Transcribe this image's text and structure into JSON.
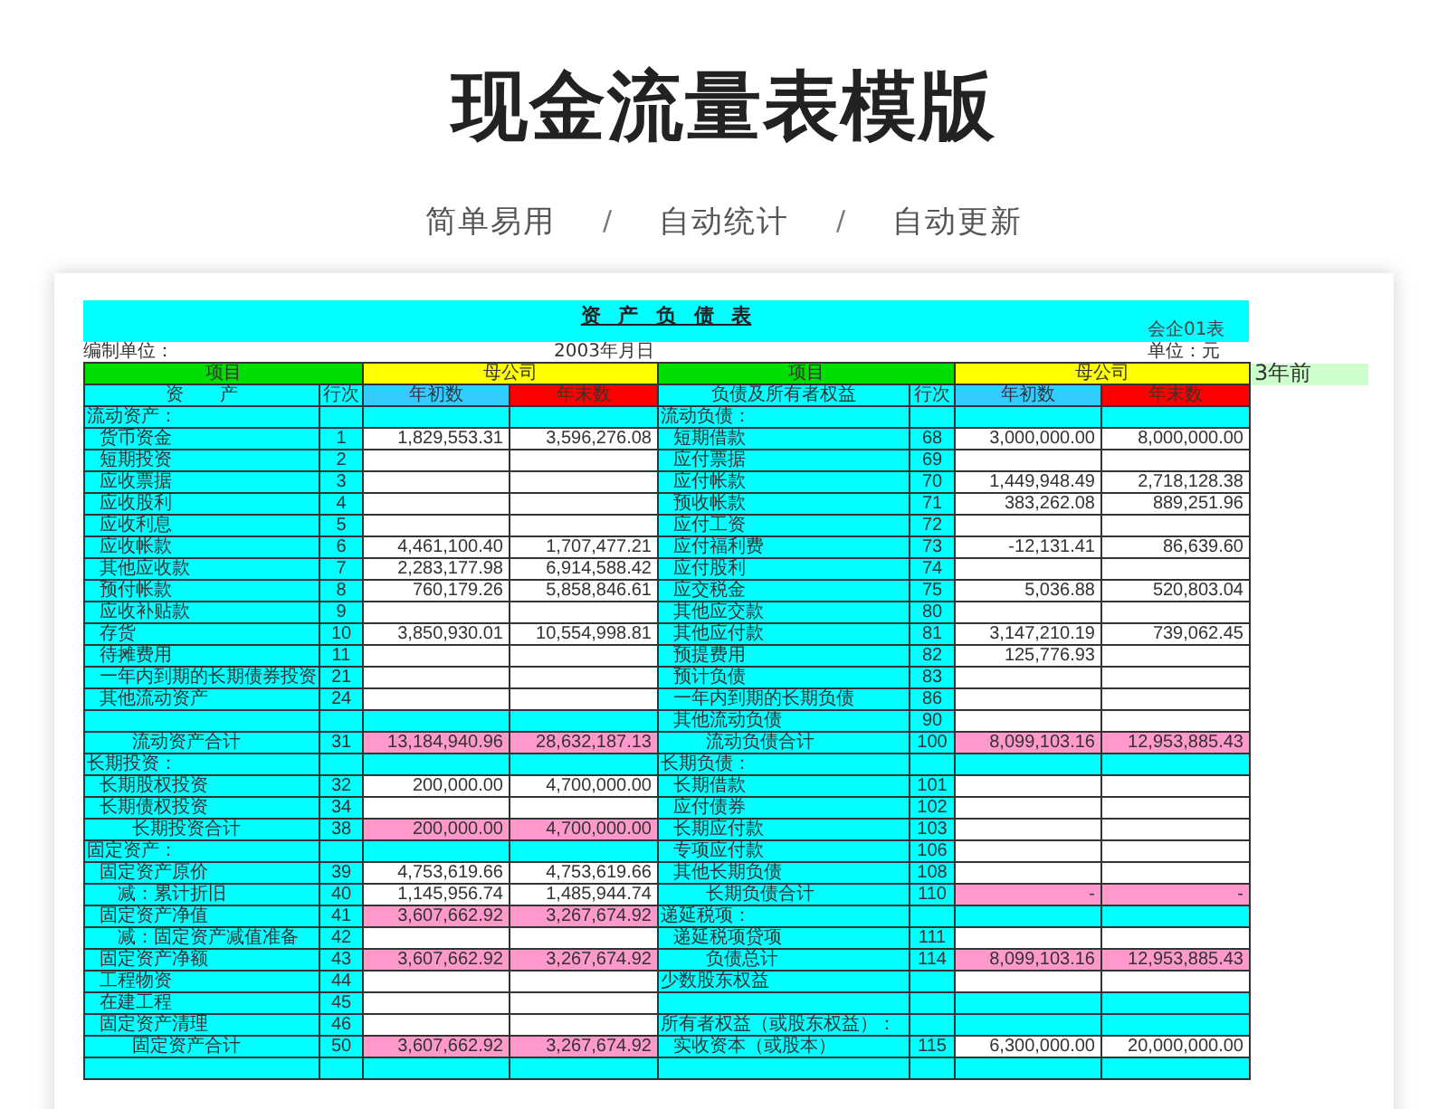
{
  "page_title": "现金流量表模版",
  "tagline": [
    {
      "kind": "phrase",
      "text": "简单易用"
    },
    {
      "kind": "separator",
      "text": "/"
    },
    {
      "kind": "phrase",
      "text": "自动统计"
    },
    {
      "kind": "separator",
      "text": "/"
    },
    {
      "kind": "phrase",
      "text": "自动更新"
    }
  ],
  "sheet": {
    "title": "资 产 负 债 表",
    "form_code": "会企01表",
    "company_label": "编制单位：",
    "date": "2003年月日",
    "unit": "单位：元",
    "group_headers": [
      {
        "label": "项目",
        "color": "#00dd00"
      },
      {
        "label": "母公司",
        "color": "#ffff00"
      },
      {
        "label": "项目",
        "color": "#00dd00"
      },
      {
        "label": "母公司",
        "color": "#ffff00"
      }
    ],
    "side_note": "3年前",
    "columns": [
      {
        "label": "资　　产",
        "color": "#00ffff"
      },
      {
        "label": "行次",
        "color": "#00ffff"
      },
      {
        "label": "年初数",
        "color": "#33ccff"
      },
      {
        "label": "年末数",
        "color": "#ff0000"
      },
      {
        "label": "负债及所有者权益",
        "color": "#00ffff"
      },
      {
        "label": "行次",
        "color": "#00ffff"
      },
      {
        "label": "年初数",
        "color": "#33ccff"
      },
      {
        "label": "年末数",
        "color": "#ff0000"
      }
    ],
    "rows": [
      {
        "left": {
          "kind": "section",
          "label": "流动资产："
        },
        "right": {
          "kind": "section",
          "label": "流动负债："
        }
      },
      {
        "left": {
          "kind": "item",
          "label": "货币资金",
          "line": "1",
          "start": "1,829,553.31",
          "end": "3,596,276.08"
        },
        "right": {
          "kind": "item",
          "label": "短期借款",
          "line": "68",
          "start": "3,000,000.00",
          "end": "8,000,000.00"
        }
      },
      {
        "left": {
          "kind": "item",
          "label": "短期投资",
          "line": "2"
        },
        "right": {
          "kind": "item",
          "label": "应付票据",
          "line": "69"
        }
      },
      {
        "left": {
          "kind": "item",
          "label": "应收票据",
          "line": "3"
        },
        "right": {
          "kind": "item",
          "label": "应付帐款",
          "line": "70",
          "start": "1,449,948.49",
          "end": "2,718,128.38"
        }
      },
      {
        "left": {
          "kind": "item",
          "label": "应收股利",
          "line": "4"
        },
        "right": {
          "kind": "item",
          "label": "预收帐款",
          "line": "71",
          "start": "383,262.08",
          "end": "889,251.96"
        }
      },
      {
        "left": {
          "kind": "item",
          "label": "应收利息",
          "line": "5"
        },
        "right": {
          "kind": "item",
          "label": "应付工资",
          "line": "72"
        }
      },
      {
        "left": {
          "kind": "item",
          "label": "应收帐款",
          "line": "6",
          "start": "4,461,100.40",
          "end": "1,707,477.21"
        },
        "right": {
          "kind": "item",
          "label": "应付福利费",
          "line": "73",
          "start": "-12,131.41",
          "end": "86,639.60"
        }
      },
      {
        "left": {
          "kind": "item",
          "label": "其他应收款",
          "line": "7",
          "start": "2,283,177.98",
          "end": "6,914,588.42"
        },
        "right": {
          "kind": "item",
          "label": "应付股利",
          "line": "74"
        }
      },
      {
        "left": {
          "kind": "item",
          "label": "预付帐款",
          "line": "8",
          "start": "760,179.26",
          "end": "5,858,846.61"
        },
        "right": {
          "kind": "item",
          "label": "应交税金",
          "line": "75",
          "start": "5,036.88",
          "end": "520,803.04"
        }
      },
      {
        "left": {
          "kind": "item",
          "label": "应收补贴款",
          "line": "9"
        },
        "right": {
          "kind": "item",
          "label": "其他应交款",
          "line": "80"
        }
      },
      {
        "left": {
          "kind": "item",
          "label": "存货",
          "line": "10",
          "start": "3,850,930.01",
          "end": "10,554,998.81"
        },
        "right": {
          "kind": "item",
          "label": "其他应付款",
          "line": "81",
          "start": "3,147,210.19",
          "end": "739,062.45"
        }
      },
      {
        "left": {
          "kind": "item",
          "label": "待摊费用",
          "line": "11"
        },
        "right": {
          "kind": "item",
          "label": "预提费用",
          "line": "82",
          "start": "125,776.93"
        }
      },
      {
        "left": {
          "kind": "item",
          "label": "一年内到期的长期债券投资",
          "line": "21"
        },
        "right": {
          "kind": "item",
          "label": "预计负债",
          "line": "83"
        }
      },
      {
        "left": {
          "kind": "item",
          "label": "其他流动资产",
          "line": "24"
        },
        "right": {
          "kind": "item",
          "label": "一年内到期的长期负债",
          "line": "86"
        }
      },
      {
        "left": {
          "kind": "blank"
        },
        "right": {
          "kind": "item",
          "label": "其他流动负债",
          "line": "90"
        }
      },
      {
        "left": {
          "kind": "total",
          "label": "流动资产合计",
          "line": "31",
          "start": "13,184,940.96",
          "end": "28,632,187.13"
        },
        "right": {
          "kind": "total",
          "label": "流动负债合计",
          "line": "100",
          "start": "8,099,103.16",
          "end": "12,953,885.43"
        }
      },
      {
        "left": {
          "kind": "section",
          "label": "长期投资："
        },
        "right": {
          "kind": "section",
          "label": "长期负债："
        }
      },
      {
        "left": {
          "kind": "item",
          "label": "长期股权投资",
          "line": "32",
          "start": "200,000.00",
          "end": "4,700,000.00"
        },
        "right": {
          "kind": "item",
          "label": "长期借款",
          "line": "101"
        }
      },
      {
        "left": {
          "kind": "item",
          "label": "长期债权投资",
          "line": "34"
        },
        "right": {
          "kind": "item",
          "label": "应付债券",
          "line": "102"
        }
      },
      {
        "left": {
          "kind": "total",
          "label": "长期投资合计",
          "line": "38",
          "start": "200,000.00",
          "end": "4,700,000.00"
        },
        "right": {
          "kind": "item",
          "label": "长期应付款",
          "line": "103"
        }
      },
      {
        "left": {
          "kind": "section",
          "label": "固定资产："
        },
        "right": {
          "kind": "item",
          "label": "专项应付款",
          "line": "106"
        }
      },
      {
        "left": {
          "kind": "item",
          "label": "固定资产原价",
          "line": "39",
          "start": "4,753,619.66",
          "end": "4,753,619.66"
        },
        "right": {
          "kind": "item",
          "label": "其他长期负债",
          "line": "108"
        }
      },
      {
        "left": {
          "kind": "sub",
          "label": "减：累计折旧",
          "line": "40",
          "start": "1,145,956.74",
          "end": "1,485,944.74"
        },
        "right": {
          "kind": "total",
          "label": "长期负债合计",
          "line": "110",
          "start": "-",
          "end": "-"
        }
      },
      {
        "left": {
          "kind": "subtotal",
          "label": "固定资产净值",
          "line": "41",
          "start": "3,607,662.92",
          "end": "3,267,674.92"
        },
        "right": {
          "kind": "section",
          "label": "递延税项："
        }
      },
      {
        "left": {
          "kind": "sub",
          "label": "减：固定资产减值准备",
          "line": "42"
        },
        "right": {
          "kind": "item",
          "label": "递延税项贷项",
          "line": "111"
        }
      },
      {
        "left": {
          "kind": "subtotal",
          "label": "固定资产净额",
          "line": "43",
          "start": "3,607,662.92",
          "end": "3,267,674.92"
        },
        "right": {
          "kind": "total",
          "label": "负债总计",
          "line": "114",
          "start": "8,099,103.16",
          "end": "12,953,885.43"
        }
      },
      {
        "left": {
          "kind": "item",
          "label": "工程物资",
          "line": "44"
        },
        "right": {
          "kind": "plain",
          "label": "少数股东权益"
        }
      },
      {
        "left": {
          "kind": "item",
          "label": "在建工程",
          "line": "45"
        },
        "right": {
          "kind": "blank"
        }
      },
      {
        "left": {
          "kind": "item",
          "label": "固定资产清理",
          "line": "46"
        },
        "right": {
          "kind": "section",
          "label": "所有者权益（或股东权益）："
        }
      },
      {
        "left": {
          "kind": "total",
          "label": "固定资产合计",
          "line": "50",
          "start": "3,607,662.92",
          "end": "3,267,674.92"
        },
        "right": {
          "kind": "item",
          "label": "实收资本（或股本）",
          "line": "115",
          "start": "6,300,000.00",
          "end": "20,000,000.00"
        }
      }
    ]
  }
}
